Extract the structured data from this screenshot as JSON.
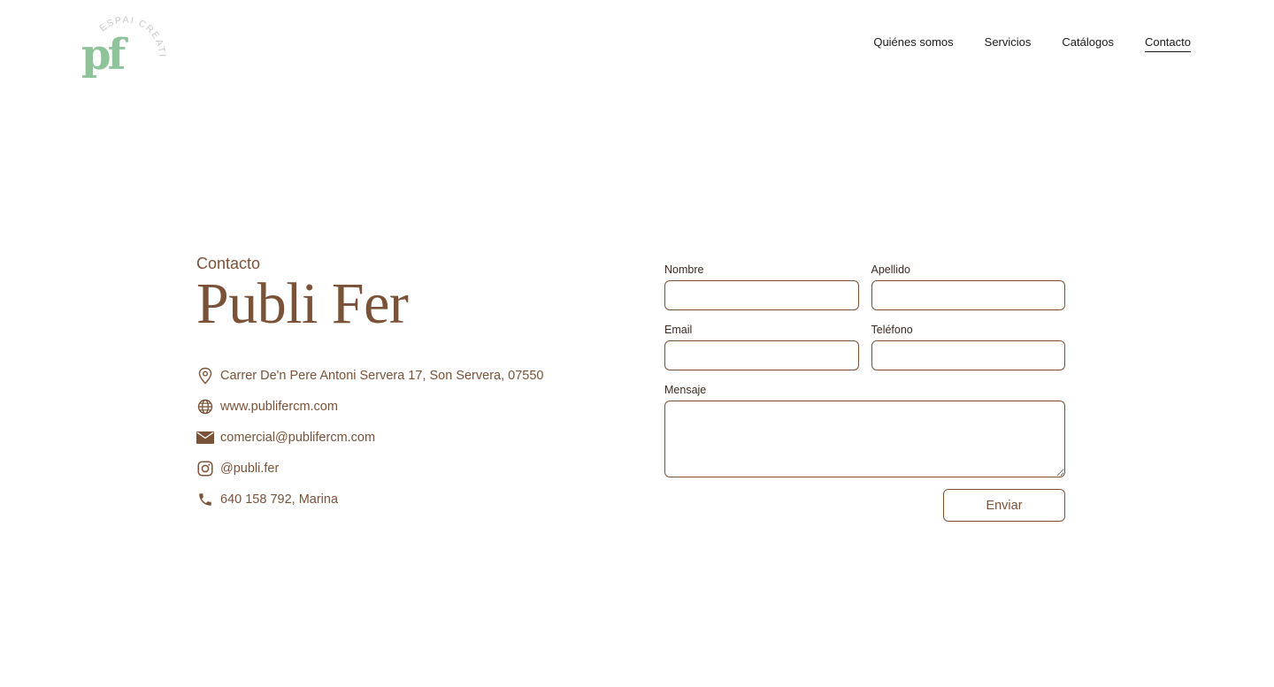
{
  "logo": {
    "mark": "pf",
    "tagline": "ESPAI CREATIU",
    "color": "#8fc49b"
  },
  "nav": {
    "items": [
      {
        "label": "Quiénes somos"
      },
      {
        "label": "Servicios"
      },
      {
        "label": "Catálogos"
      },
      {
        "label": "Contacto",
        "active": true
      }
    ]
  },
  "contact": {
    "eyebrow": "Contacto",
    "title": "Publi Fer",
    "items": [
      {
        "icon": "location-pin-icon",
        "text": "Carrer De'n Pere Antoni Servera 17, Son Servera, 07550"
      },
      {
        "icon": "globe-icon",
        "text": "www.publifercm.com"
      },
      {
        "icon": "envelope-icon",
        "text": "comercial@publifercm.com"
      },
      {
        "icon": "instagram-icon",
        "text": "@publi.fer"
      },
      {
        "icon": "phone-icon",
        "text": "640 158 792, Marina"
      }
    ]
  },
  "form": {
    "first_name_label": "Nombre",
    "first_name_value": "",
    "last_name_label": "Apellido",
    "last_name_value": "",
    "email_label": "Email",
    "email_value": "",
    "phone_label": "Teléfono",
    "phone_value": "",
    "message_label": "Mensaje",
    "message_value": "",
    "submit_label": "Enviar"
  },
  "colors": {
    "brown": "#7a5238",
    "green": "#8fc49b",
    "text_dark": "#1a1a1a"
  }
}
